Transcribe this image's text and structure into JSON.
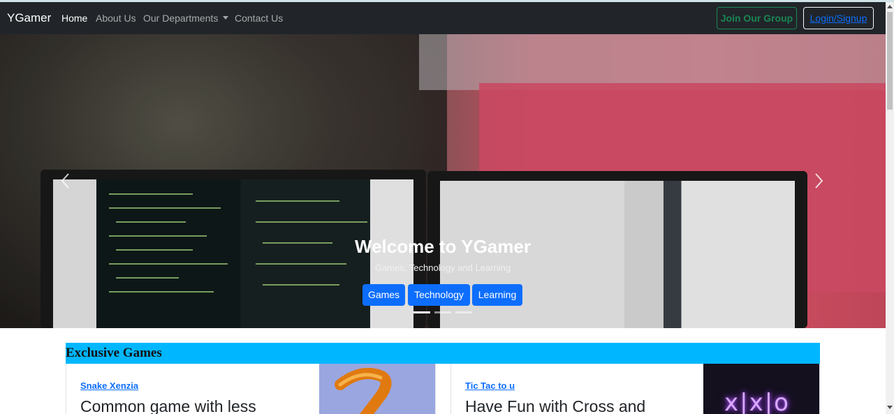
{
  "navbar": {
    "brand": "YGamer",
    "links": [
      {
        "label": "Home",
        "active": true
      },
      {
        "label": "About Us"
      },
      {
        "label": "Our Departments",
        "dropdown": true
      },
      {
        "label": "Contact Us"
      }
    ],
    "join_label": "Join Our Group",
    "login_label": "Login/Signup"
  },
  "carousel": {
    "title": "Welcome to YGamer",
    "subtitle": "Games, Technology and Learning",
    "buttons": [
      "Games",
      "Technology",
      "Learning"
    ],
    "indicators": 3,
    "active_indicator": 0
  },
  "exclusive": {
    "heading": "Exclusive Games",
    "cards": [
      {
        "link": "Snake Xenzia",
        "title": "Common game with less"
      },
      {
        "link": "Tic Tac to u",
        "title": "Have Fun with Cross and",
        "image_text": "x|x|o"
      }
    ]
  },
  "colors": {
    "navbar_bg": "#212529",
    "primary": "#0d6efd",
    "success": "#198754",
    "section_bg": "#00b7ff"
  }
}
